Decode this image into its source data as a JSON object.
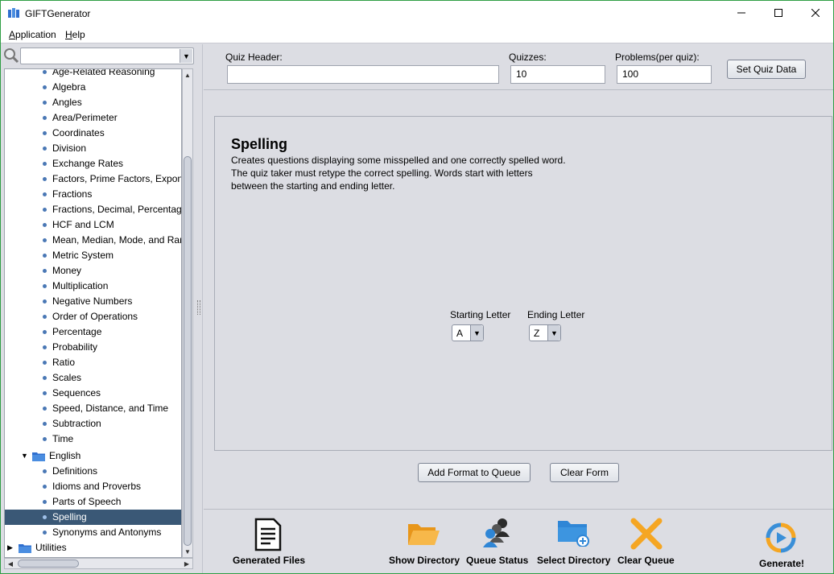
{
  "window": {
    "title": "GIFTGenerator"
  },
  "menu": [
    {
      "label": "Application",
      "u": "A",
      "rest": "pplication"
    },
    {
      "label": "Help",
      "u": "H",
      "rest": "elp"
    }
  ],
  "tree": {
    "math_items": [
      "Age-Related Reasoning",
      "Algebra",
      "Angles",
      "Area/Perimeter",
      "Coordinates",
      "Division",
      "Exchange Rates",
      "Factors, Prime Factors, Expon",
      "Fractions",
      "Fractions, Decimal, Percentag",
      "HCF and LCM",
      "Mean, Median, Mode, and Ran",
      "Metric System",
      "Money",
      "Multiplication",
      "Negative Numbers",
      "Order of Operations",
      "Percentage",
      "Probability",
      "Ratio",
      "Scales",
      "Sequences",
      "Speed, Distance, and Time",
      "Subtraction",
      "Time"
    ],
    "english_folder": "English",
    "english_items": [
      "Definitions",
      "Idioms and Proverbs",
      "Parts of Speech",
      "Spelling",
      "Synonyms and Antonyms"
    ],
    "selected": "Spelling",
    "utilities_folder": "Utilities"
  },
  "form": {
    "quiz_header_label": "Quiz Header:",
    "quiz_header_value": "",
    "quizzes_label": "Quizzes:",
    "quizzes_value": "10",
    "problems_label": "Problems(per quiz):",
    "problems_value": "100",
    "set_button": "Set Quiz Data"
  },
  "content": {
    "title": "Spelling",
    "desc": [
      "Creates questions displaying some misspelled and one correctly spelled word.",
      "The quiz taker must retype the correct spelling. Words start with letters",
      "between the starting and ending letter."
    ],
    "starting_label": "Starting Letter",
    "starting_value": "A",
    "ending_label": "Ending Letter",
    "ending_value": "Z",
    "add_button": "Add Format to Queue",
    "clear_form_button": "Clear Form"
  },
  "toolbar": {
    "generated_files": "Generated Files",
    "show_directory": "Show Directory",
    "queue_status": "Queue Status",
    "select_directory": "Select Directory",
    "clear_queue": "Clear Queue",
    "generate": "Generate!"
  },
  "colors": {
    "selection": "#3a5876",
    "folder": "#2f6fcf",
    "orange": "#f5a623",
    "blue": "#2f86d6"
  }
}
